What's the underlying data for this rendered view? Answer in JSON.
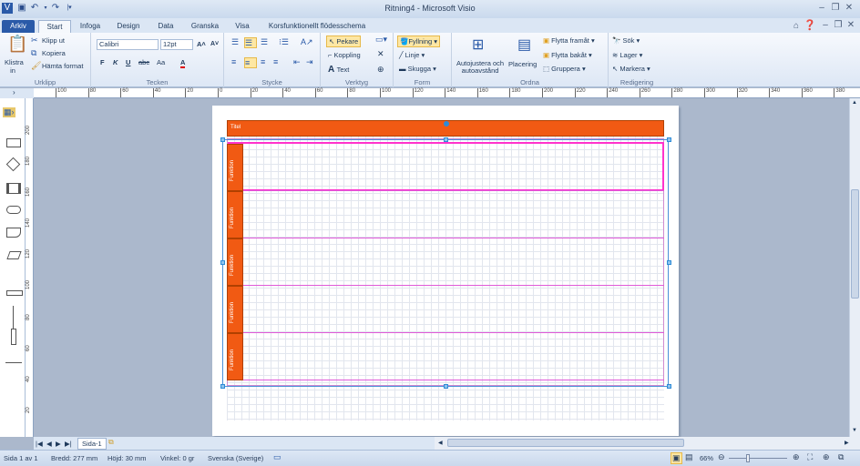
{
  "window": {
    "title": "Ritning4 - Microsoft Visio"
  },
  "tabs": [
    "Arkiv",
    "Start",
    "Infoga",
    "Design",
    "Data",
    "Granska",
    "Visa",
    "Korsfunktionellt flödesschema"
  ],
  "clipboard": {
    "paste": "Klistra in",
    "cut": "Klipp ut",
    "copy": "Kopiera",
    "format": "Hämta format",
    "label": "Urklipp"
  },
  "font": {
    "name": "Calibri",
    "size": "12pt",
    "label": "Tecken",
    "bold": "F",
    "italic": "K",
    "underline": "U",
    "strike": "abc",
    "case": "Aa",
    "color": "A"
  },
  "paragraph": {
    "label": "Stycke"
  },
  "tools": {
    "pointer": "Pekare",
    "connector": "Koppling",
    "text": "Text",
    "label": "Verktyg"
  },
  "shape": {
    "fill": "Fyllning",
    "line": "Linje",
    "shadow": "Skugga",
    "label": "Form"
  },
  "arrange": {
    "auto": "Autojustera och autoavstånd",
    "position": "Placering",
    "front": "Flytta framåt",
    "back": "Flytta bakåt",
    "group": "Gruppera",
    "label": "Ordna"
  },
  "editing": {
    "find": "Sök",
    "layers": "Lager",
    "select": "Markera",
    "label": "Redigering"
  },
  "ruler_top": [
    "100",
    "80",
    "60",
    "40",
    "20",
    "0",
    "20",
    "40",
    "60",
    "80",
    "100",
    "120",
    "140",
    "160",
    "180",
    "200",
    "220",
    "240",
    "260",
    "280",
    "300",
    "320",
    "340",
    "360",
    "380",
    "400"
  ],
  "ruler_left": [
    "200",
    "180",
    "160",
    "140",
    "120",
    "100",
    "80",
    "60",
    "40",
    "20"
  ],
  "diagram": {
    "title": "Titel",
    "lanes": [
      "Funktion",
      "Funktion",
      "Funktion",
      "Funktion",
      "Funktion"
    ]
  },
  "sheet": {
    "name": "Sida-1"
  },
  "status": {
    "page": "Sida 1 av 1",
    "width": "Bredd: 277 mm",
    "height": "Höjd: 30 mm",
    "angle": "Vinkel: 0 gr",
    "language": "Svenska (Sverige)",
    "zoom": "66%"
  },
  "colors": {
    "lane_header": "#f15a13",
    "selection": "#ff33cc",
    "handle": "#2e8bd6"
  }
}
